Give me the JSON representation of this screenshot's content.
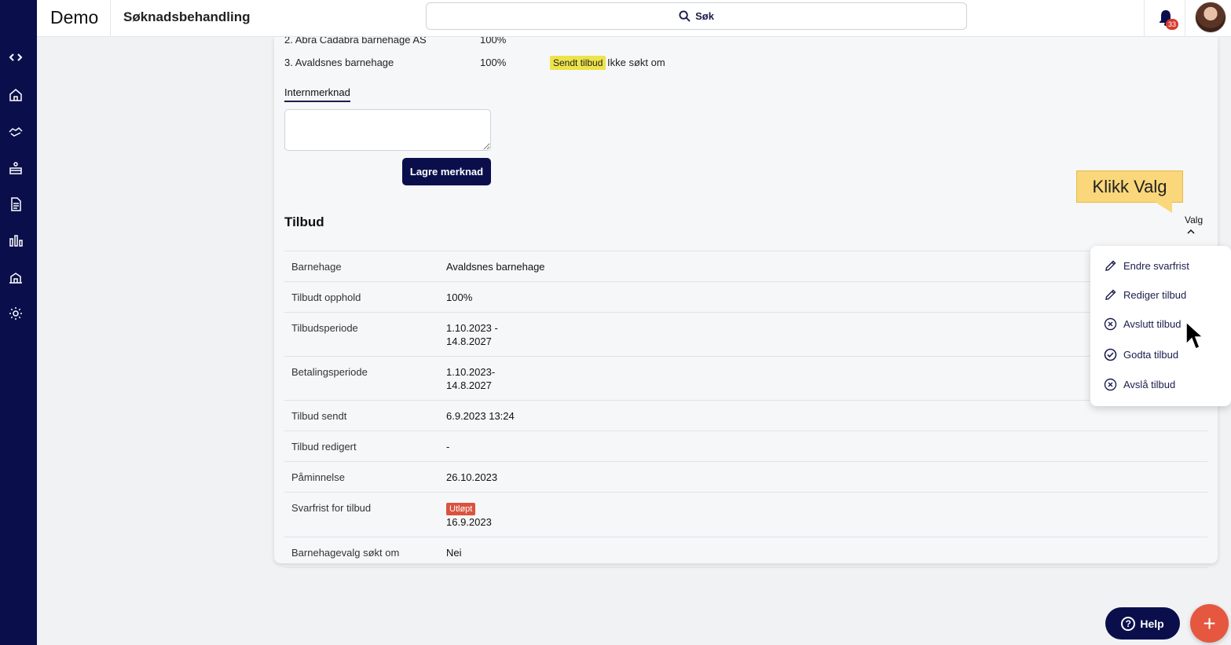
{
  "header": {
    "brand": "Demo",
    "page_title": "Søknadsbehandling",
    "search_label": "Søk",
    "notification_count": "33"
  },
  "sidebar": {
    "icons": [
      "apps-grid-icon",
      "code-icon",
      "home-icon",
      "handshake-icon",
      "kindergarten-icon",
      "document-icon",
      "chart-icon",
      "building-icon",
      "gear-icon"
    ]
  },
  "applications": [
    {
      "name": "2. Abra Cadabra barnehage AS",
      "percent": "100%"
    },
    {
      "name": "3. Avaldsnes barnehage",
      "percent": "100%",
      "status_tag": "Sendt tilbud",
      "status_text": "Ikke søkt om"
    }
  ],
  "internal_note": {
    "label": "Internmerknad",
    "value": "",
    "save_label": "Lagre merknad"
  },
  "offer": {
    "title": "Tilbud",
    "options_label": "Valg",
    "rows": [
      {
        "key": "Barnehage",
        "value": "Avaldsnes barnehage"
      },
      {
        "key": "Tilbudt opphold",
        "value": "100%"
      },
      {
        "key": "Tilbudsperiode",
        "value": "1.10.2023 -",
        "value2": "14.8.2027"
      },
      {
        "key": "Betalingsperiode",
        "value": "1.10.2023-",
        "value2": "14.8.2027"
      },
      {
        "key": "Tilbud sendt",
        "value": "6.9.2023 13:24"
      },
      {
        "key": "Tilbud redigert",
        "value": "-"
      },
      {
        "key": "Påminnelse",
        "value": "26.10.2023"
      },
      {
        "key": "Svarfrist for tilbud",
        "tag": "Utløpt",
        "value": "16.9.2023"
      },
      {
        "key": "Barnehagevalg søkt om",
        "value": "Nei"
      }
    ]
  },
  "menu": {
    "items": [
      {
        "label": "Endre svarfrist",
        "icon": "pencil-icon"
      },
      {
        "label": "Rediger tilbud",
        "icon": "pencil-icon"
      },
      {
        "label": "Avslutt tilbud",
        "icon": "x-circle-icon"
      },
      {
        "label": "Godta tilbud",
        "icon": "check-circle-icon"
      },
      {
        "label": "Avslå tilbud",
        "icon": "x-circle-icon"
      }
    ]
  },
  "callout": "Klikk Valg",
  "help_label": "Help",
  "fab_label": "+",
  "colors": {
    "navy": "#0a0f4c",
    "accent_red": "#e5573f",
    "tag_yellow": "#ede34a",
    "tag_red": "#d9533f",
    "callout": "#fad77a"
  }
}
